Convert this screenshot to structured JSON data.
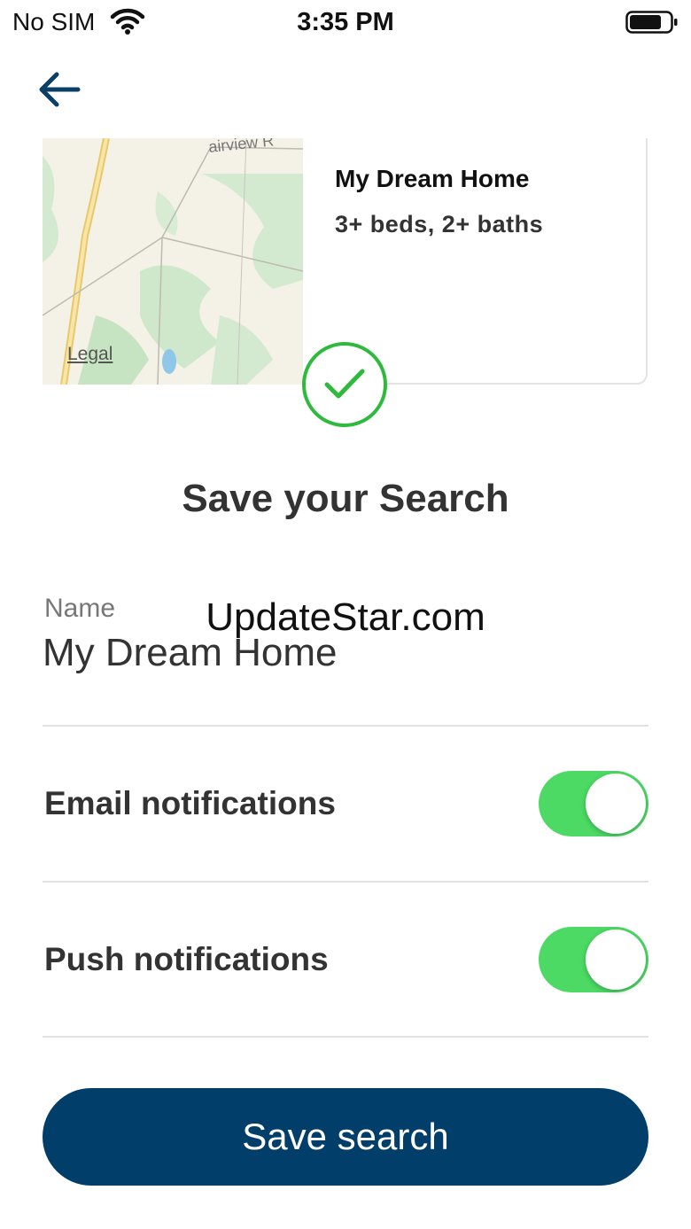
{
  "status_bar": {
    "carrier": "No SIM",
    "time": "3:35 PM"
  },
  "nav": {
    "back_icon": "arrow-left-icon"
  },
  "search_card": {
    "map_road_label": "airview R",
    "map_legal": "Legal",
    "title": "My Dream Home",
    "subtitle": "3+ beds, 2+ baths"
  },
  "confirmation": {
    "icon": "checkmark-circle-icon",
    "color": "#2fba3d"
  },
  "form": {
    "heading": "Save your Search",
    "name_label": "Name",
    "name_value": "My Dream Home",
    "watermark": "UpdateStar.com",
    "email_label": "Email notifications",
    "email_enabled": true,
    "push_label": "Push notifications",
    "push_enabled": true,
    "toggle_on_color": "#4cd964"
  },
  "actions": {
    "save_label": "Save search",
    "save_color": "#023e6a"
  }
}
